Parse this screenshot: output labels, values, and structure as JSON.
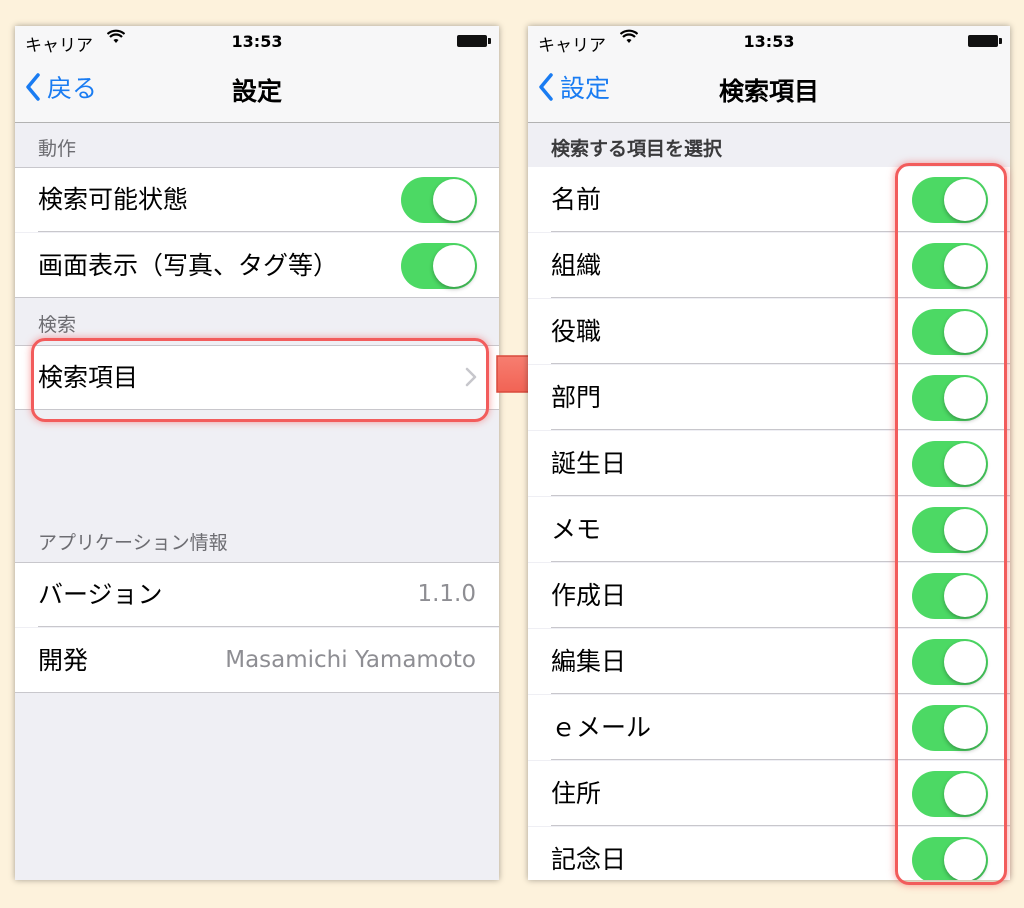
{
  "left": {
    "status": {
      "carrier": "キャリア",
      "time": "13:53"
    },
    "nav": {
      "back_label": "戻る",
      "title": "設定"
    },
    "sections": {
      "action_header": "動作",
      "search_header": "検索",
      "appinfo_header": "アプリケーション情報"
    },
    "rows": {
      "searchable": "検索可能状態",
      "screen_display": "画面表示（写真、タグ等）",
      "search_items": "検索項目",
      "version_label": "バージョン",
      "version_value": "1.1.0",
      "developer_label": "開発",
      "developer_value": "Masamichi Yamamoto"
    },
    "toggles": {
      "searchable": true,
      "screen_display": true
    }
  },
  "right": {
    "status": {
      "carrier": "キャリア",
      "time": "13:53"
    },
    "nav": {
      "back_label": "設定",
      "title": "検索項目"
    },
    "section_header": "検索する項目を選択",
    "items": [
      {
        "label": "名前",
        "on": true
      },
      {
        "label": "組織",
        "on": true
      },
      {
        "label": "役職",
        "on": true
      },
      {
        "label": "部門",
        "on": true
      },
      {
        "label": "誕生日",
        "on": true
      },
      {
        "label": "メモ",
        "on": true
      },
      {
        "label": "作成日",
        "on": true
      },
      {
        "label": "編集日",
        "on": true
      },
      {
        "label": "ｅメール",
        "on": true
      },
      {
        "label": "住所",
        "on": true
      },
      {
        "label": "記念日",
        "on": true
      }
    ]
  },
  "colors": {
    "background": "#fdf2dc",
    "accent": "#1a7cf2",
    "toggle_on": "#4cd964",
    "highlight": "#f25c5c",
    "arrow": "#f46b5f"
  }
}
